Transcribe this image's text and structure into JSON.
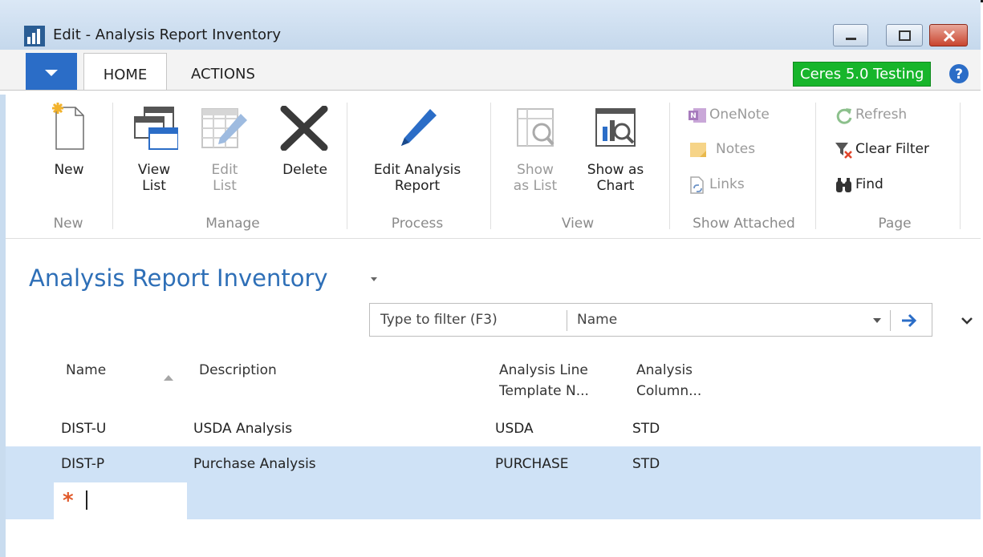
{
  "window": {
    "title": "Edit - Analysis Report Inventory"
  },
  "ribbon_tabs": {
    "home": "HOME",
    "actions": "ACTIONS"
  },
  "company": "Ceres 5.0 Testing",
  "ribbon": {
    "new": {
      "label": "New",
      "group": "New"
    },
    "manage": {
      "group": "Manage",
      "view_list": "View\nList",
      "edit_list": "Edit\nList",
      "delete": "Delete"
    },
    "process": {
      "group": "Process",
      "edit_analysis_report": "Edit Analysis\nReport"
    },
    "view": {
      "group": "View",
      "show_as_list": "Show\nas List",
      "show_as_chart": "Show as\nChart"
    },
    "show_attached": {
      "group": "Show Attached",
      "onenote": "OneNote",
      "notes": "Notes",
      "links": "Links"
    },
    "page": {
      "group": "Page",
      "refresh": "Refresh",
      "clear_filter": "Clear Filter",
      "find": "Find"
    }
  },
  "page_title": "Analysis Report Inventory",
  "filter": {
    "placeholder": "Type to filter (F3)",
    "field": "Name"
  },
  "table": {
    "columns": {
      "name": "Name",
      "description": "Description",
      "line_template": "Analysis Line\nTemplate N...",
      "column": "Analysis\nColumn..."
    },
    "rows": [
      {
        "name": "DIST-U",
        "description": "USDA Analysis",
        "line_template": "USDA",
        "column": "STD"
      },
      {
        "name": "DIST-P",
        "description": "Purchase Analysis",
        "line_template": "PURCHASE",
        "column": "STD"
      }
    ],
    "new_row_marker": "*"
  }
}
